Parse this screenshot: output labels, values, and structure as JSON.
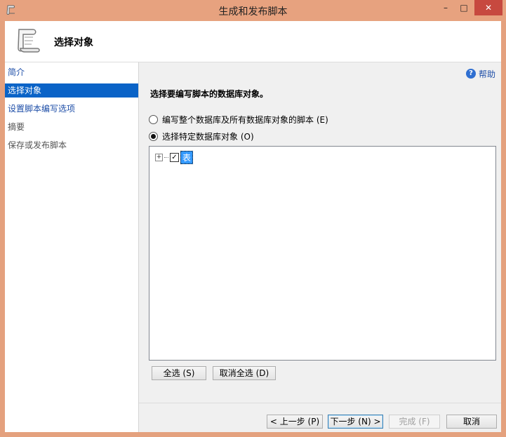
{
  "window": {
    "title": "生成和发布脚本"
  },
  "titlebar": {
    "minimize": "–",
    "maximize": "□",
    "close": "✕"
  },
  "header": {
    "title": "选择对象"
  },
  "nav": {
    "items": [
      {
        "label": "简介"
      },
      {
        "label": "选择对象"
      },
      {
        "label": "设置脚本编写选项"
      },
      {
        "label": "摘要"
      },
      {
        "label": "保存或发布脚本"
      }
    ]
  },
  "content": {
    "help_label": "帮助",
    "prompt": "选择要编写脚本的数据库对象。",
    "option_all": "编写整个数据库及所有数据库对象的脚本 (E)",
    "option_specific": "选择特定数据库对象 (O)",
    "tree": {
      "node_label": "表",
      "expander": "+",
      "check": "✓"
    },
    "select_all": "全选 (S)",
    "deselect_all": "取消全选 (D)"
  },
  "footer": {
    "prev": "< 上一步 (P)",
    "next": "下一步 (N) >",
    "finish": "完成 (F)",
    "cancel": "取消"
  },
  "colors": {
    "titlebar": "#e7a27f",
    "selection": "#0a63c7",
    "close": "#c7493f"
  },
  "icons": {
    "title_icon": "scroll-icon",
    "header_icon": "scroll-icon",
    "help_icon": "help-icon"
  }
}
